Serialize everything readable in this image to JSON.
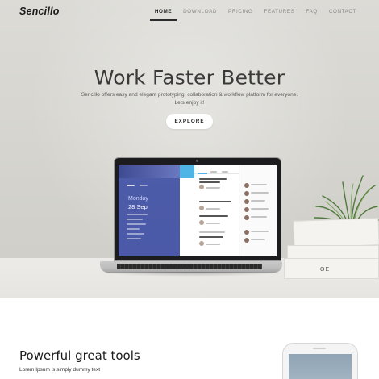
{
  "nav": {
    "logo": "Sencillo",
    "items": [
      {
        "label": "HOME",
        "active": true
      },
      {
        "label": "DOWNLOAD",
        "active": false
      },
      {
        "label": "PRICING",
        "active": false
      },
      {
        "label": "FEATURES",
        "active": false
      },
      {
        "label": "FAQ",
        "active": false
      },
      {
        "label": "CONTACT",
        "active": false
      }
    ]
  },
  "hero": {
    "title": "Work Faster Better",
    "subtitle": "Sencillo offers easy and elegant prototyping, collaboration & workflow platform for everyone. Lets enjoy it!",
    "button_label": "EXPLORE"
  },
  "screen": {
    "day": "Monday",
    "date": "28 Sep"
  },
  "books": {
    "label": "OE"
  },
  "tools": {
    "heading": "Powerful great tools",
    "subtext": "Lorem Ipsum is simply dummy text"
  },
  "colors": {
    "accent_blue": "#4fb4e6",
    "app_sidebar": "#4c5ca8",
    "hero_bg": "#d6d5cf"
  }
}
